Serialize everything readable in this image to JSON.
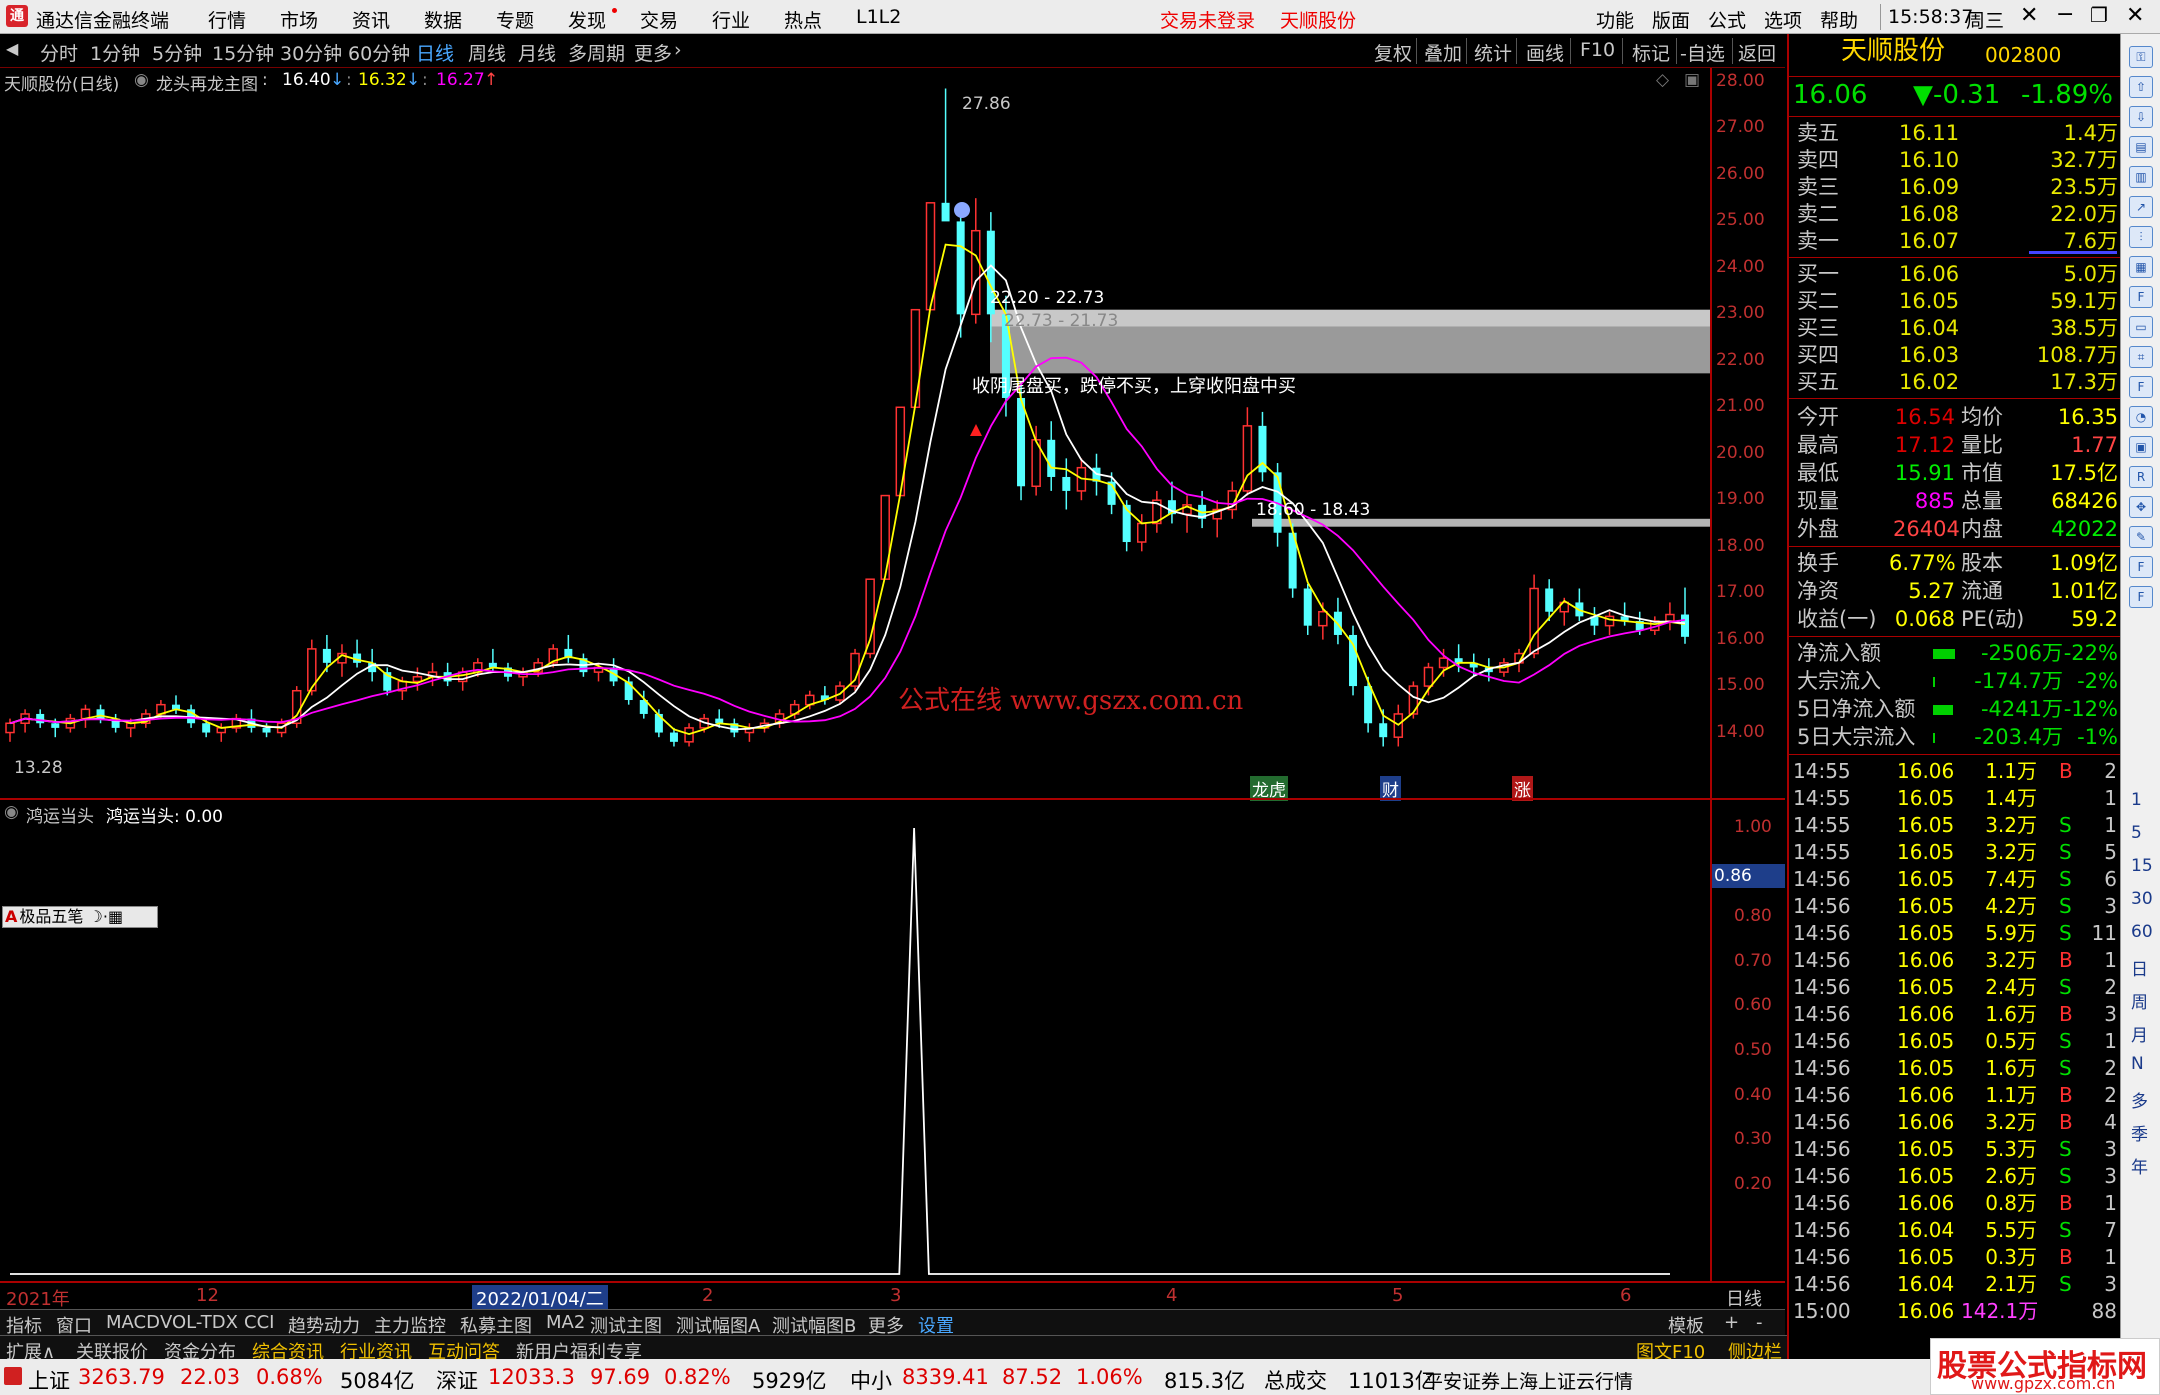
{
  "app": {
    "title": "通达信金融终端",
    "login_status": "交易未登录",
    "stock_name": "天顺股份",
    "time": "15:58:37",
    "weekday": "周三"
  },
  "menu": {
    "items": [
      "行情",
      "市场",
      "资讯",
      "数据",
      "专题",
      "发现",
      "交易",
      "行业",
      "热点",
      "L1L2"
    ],
    "right": [
      "功能",
      "版面",
      "公式",
      "选项",
      "帮助"
    ]
  },
  "periods": [
    "分时",
    "1分钟",
    "5分钟",
    "15分钟",
    "30分钟",
    "60分钟",
    "日线",
    "周线",
    "月线",
    "多周期",
    "更多"
  ],
  "tools": [
    "复权",
    "叠加",
    "统计",
    "画线",
    "F10",
    "标记",
    "-自选",
    "返回"
  ],
  "main_chart": {
    "header_name": "天顺股份(日线)",
    "indicator": "龙头再龙主图",
    "v1": "16.40",
    "v2": "16.32",
    "v3": "16.27",
    "high_label": "27.86",
    "low_label": "13.28",
    "zone1_a": "22.20 - 22.73",
    "zone1_b": "22.73 - 21.73",
    "zone2": "18.60 - 18.43",
    "annotation": "收阴尾盘买，跌停不买，上穿收阳盘中买",
    "watermark": "公式在线   www.gszx.com.cn",
    "markers": [
      "龙虎",
      "财",
      "涨"
    ]
  },
  "sub_chart": {
    "name": "鸿运当头",
    "label": "鸿运当头: 0.00",
    "badge": "0.86",
    "toolbar_label": "极品五笔"
  },
  "chart_data": [
    {
      "type": "candlestick",
      "title": "龙头再龙主图",
      "ylim": [
        13.28,
        28.0
      ],
      "yticks": [
        "28.00",
        "27.00",
        "26.00",
        "25.00",
        "24.00",
        "23.00",
        "22.00",
        "21.00",
        "20.00",
        "19.00",
        "18.00",
        "17.00",
        "16.00",
        "15.00",
        "14.00"
      ],
      "x_labels": [
        "2021年",
        "12",
        "2022/01/04/二",
        "2",
        "3",
        "4",
        "5",
        "6"
      ],
      "ohlc": [
        [
          14.0,
          14.3,
          13.8,
          14.2
        ],
        [
          14.2,
          14.5,
          14.0,
          14.4
        ],
        [
          14.4,
          14.5,
          14.1,
          14.2
        ],
        [
          14.2,
          14.3,
          13.9,
          14.1
        ],
        [
          14.1,
          14.4,
          14.0,
          14.3
        ],
        [
          14.3,
          14.6,
          14.1,
          14.5
        ],
        [
          14.5,
          14.6,
          14.2,
          14.3
        ],
        [
          14.3,
          14.4,
          14.0,
          14.1
        ],
        [
          14.1,
          14.3,
          13.9,
          14.2
        ],
        [
          14.2,
          14.5,
          14.1,
          14.4
        ],
        [
          14.4,
          14.7,
          14.3,
          14.6
        ],
        [
          14.6,
          14.8,
          14.4,
          14.5
        ],
        [
          14.5,
          14.6,
          14.1,
          14.2
        ],
        [
          14.2,
          14.3,
          13.9,
          14.0
        ],
        [
          14.0,
          14.2,
          13.8,
          14.1
        ],
        [
          14.1,
          14.4,
          14.0,
          14.3
        ],
        [
          14.3,
          14.5,
          14.0,
          14.1
        ],
        [
          14.1,
          14.2,
          13.9,
          14.0
        ],
        [
          14.0,
          14.3,
          13.9,
          14.2
        ],
        [
          14.2,
          15.0,
          14.1,
          14.9
        ],
        [
          14.9,
          16.0,
          14.8,
          15.8
        ],
        [
          15.8,
          16.1,
          15.3,
          15.5
        ],
        [
          15.5,
          15.9,
          15.2,
          15.7
        ],
        [
          15.7,
          16.0,
          15.4,
          15.5
        ],
        [
          15.5,
          15.8,
          15.1,
          15.3
        ],
        [
          15.3,
          15.4,
          14.8,
          14.9
        ],
        [
          14.9,
          15.2,
          14.7,
          15.1
        ],
        [
          15.1,
          15.4,
          14.9,
          15.2
        ],
        [
          15.2,
          15.5,
          15.0,
          15.3
        ],
        [
          15.3,
          15.5,
          15.0,
          15.1
        ],
        [
          15.1,
          15.4,
          14.9,
          15.3
        ],
        [
          15.3,
          15.6,
          15.2,
          15.5
        ],
        [
          15.5,
          15.8,
          15.3,
          15.4
        ],
        [
          15.4,
          15.5,
          15.1,
          15.2
        ],
        [
          15.2,
          15.4,
          15.0,
          15.3
        ],
        [
          15.3,
          15.6,
          15.2,
          15.5
        ],
        [
          15.5,
          15.9,
          15.4,
          15.8
        ],
        [
          15.8,
          16.1,
          15.5,
          15.6
        ],
        [
          15.6,
          15.7,
          15.2,
          15.3
        ],
        [
          15.3,
          15.5,
          15.1,
          15.4
        ],
        [
          15.4,
          15.6,
          15.0,
          15.1
        ],
        [
          15.1,
          15.2,
          14.6,
          14.7
        ],
        [
          14.7,
          14.9,
          14.3,
          14.4
        ],
        [
          14.4,
          14.5,
          13.9,
          14.0
        ],
        [
          14.0,
          14.1,
          13.7,
          13.8
        ],
        [
          13.8,
          14.2,
          13.7,
          14.1
        ],
        [
          14.1,
          14.4,
          14.0,
          14.3
        ],
        [
          14.3,
          14.5,
          14.1,
          14.2
        ],
        [
          14.2,
          14.3,
          13.9,
          14.0
        ],
        [
          14.0,
          14.2,
          13.8,
          14.1
        ],
        [
          14.1,
          14.3,
          14.0,
          14.2
        ],
        [
          14.2,
          14.5,
          14.1,
          14.4
        ],
        [
          14.4,
          14.7,
          14.3,
          14.6
        ],
        [
          14.6,
          14.9,
          14.5,
          14.8
        ],
        [
          14.8,
          15.0,
          14.6,
          14.7
        ],
        [
          14.7,
          15.1,
          14.6,
          15.0
        ],
        [
          15.0,
          15.8,
          14.9,
          15.7
        ],
        [
          15.7,
          17.3,
          15.6,
          17.3
        ],
        [
          17.3,
          19.1,
          17.3,
          19.1
        ],
        [
          19.1,
          21.0,
          19.1,
          21.0
        ],
        [
          21.0,
          23.1,
          21.0,
          23.1
        ],
        [
          23.1,
          25.4,
          23.1,
          25.4
        ],
        [
          25.4,
          27.86,
          25.2,
          25.0
        ],
        [
          25.0,
          25.3,
          22.5,
          23.0
        ],
        [
          23.0,
          25.5,
          22.8,
          24.8
        ],
        [
          24.8,
          25.2,
          22.4,
          23.0
        ],
        [
          23.0,
          23.4,
          20.8,
          21.2
        ],
        [
          21.2,
          21.5,
          19.0,
          19.3
        ],
        [
          19.3,
          20.6,
          19.1,
          20.3
        ],
        [
          20.3,
          20.7,
          19.2,
          19.5
        ],
        [
          19.5,
          19.9,
          18.8,
          19.2
        ],
        [
          19.2,
          19.9,
          19.0,
          19.7
        ],
        [
          19.7,
          20.0,
          19.1,
          19.4
        ],
        [
          19.4,
          19.6,
          18.7,
          18.9
        ],
        [
          18.9,
          19.0,
          17.9,
          18.1
        ],
        [
          18.1,
          18.7,
          17.9,
          18.5
        ],
        [
          18.5,
          19.2,
          18.3,
          19.0
        ],
        [
          19.0,
          19.4,
          18.5,
          18.7
        ],
        [
          18.7,
          19.1,
          18.3,
          18.9
        ],
        [
          18.9,
          19.2,
          18.4,
          18.6
        ],
        [
          18.6,
          19.0,
          18.2,
          18.8
        ],
        [
          18.8,
          19.4,
          18.6,
          19.2
        ],
        [
          19.2,
          21.0,
          19.1,
          20.6
        ],
        [
          20.6,
          20.9,
          19.4,
          19.6
        ],
        [
          19.6,
          19.8,
          18.0,
          18.3
        ],
        [
          18.3,
          18.5,
          16.9,
          17.1
        ],
        [
          17.1,
          17.2,
          16.1,
          16.3
        ],
        [
          16.3,
          16.8,
          16.0,
          16.6
        ],
        [
          16.6,
          16.9,
          15.9,
          16.1
        ],
        [
          16.1,
          16.3,
          14.8,
          15.0
        ],
        [
          15.0,
          15.2,
          14.0,
          14.2
        ],
        [
          14.2,
          14.5,
          13.7,
          13.9
        ],
        [
          13.9,
          14.6,
          13.7,
          14.4
        ],
        [
          14.4,
          15.1,
          14.3,
          15.0
        ],
        [
          15.0,
          15.5,
          14.8,
          15.4
        ],
        [
          15.4,
          15.8,
          15.2,
          15.6
        ],
        [
          15.6,
          15.9,
          15.3,
          15.5
        ],
        [
          15.5,
          15.7,
          15.2,
          15.4
        ],
        [
          15.4,
          15.6,
          15.1,
          15.3
        ],
        [
          15.3,
          15.6,
          15.2,
          15.5
        ],
        [
          15.5,
          15.8,
          15.3,
          15.7
        ],
        [
          15.7,
          17.4,
          15.6,
          17.1
        ],
        [
          17.1,
          17.3,
          16.4,
          16.6
        ],
        [
          16.6,
          16.9,
          16.3,
          16.8
        ],
        [
          16.8,
          17.1,
          16.4,
          16.5
        ],
        [
          16.5,
          16.7,
          16.1,
          16.3
        ],
        [
          16.3,
          16.6,
          16.1,
          16.5
        ],
        [
          16.5,
          16.8,
          16.3,
          16.4
        ],
        [
          16.4,
          16.6,
          16.1,
          16.2
        ],
        [
          16.2,
          16.5,
          16.1,
          16.4
        ],
        [
          16.4,
          16.8,
          16.2,
          16.54
        ],
        [
          16.54,
          17.12,
          15.91,
          16.06
        ]
      ],
      "series": [
        {
          "name": "16.40",
          "color": "#ffffff"
        },
        {
          "name": "16.32",
          "color": "#ffff00"
        },
        {
          "name": "16.27",
          "color": "#ff00ff"
        }
      ]
    },
    {
      "type": "line",
      "title": "鸿运当头",
      "ylim": [
        0,
        1
      ],
      "yticks": [
        "1.00",
        "0.80",
        "0.70",
        "0.60",
        "0.50",
        "0.40",
        "0.30",
        "0.20"
      ],
      "spike_index": 61,
      "spike_value": 1.0,
      "count": 113
    }
  ],
  "quote": {
    "name": "天顺股份",
    "code": "002800",
    "price": "16.06",
    "change": "▼-0.31",
    "pct": "-1.89%",
    "asks": [
      {
        "label": "卖五",
        "price": "16.11",
        "vol": "1.4万"
      },
      {
        "label": "卖四",
        "price": "16.10",
        "vol": "32.7万"
      },
      {
        "label": "卖三",
        "price": "16.09",
        "vol": "23.5万"
      },
      {
        "label": "卖二",
        "price": "16.08",
        "vol": "22.0万"
      },
      {
        "label": "卖一",
        "price": "16.07",
        "vol": "7.6万"
      }
    ],
    "bids": [
      {
        "label": "买一",
        "price": "16.06",
        "vol": "5.0万"
      },
      {
        "label": "买二",
        "price": "16.05",
        "vol": "59.1万"
      },
      {
        "label": "买三",
        "price": "16.04",
        "vol": "38.5万"
      },
      {
        "label": "买四",
        "price": "16.03",
        "vol": "108.7万"
      },
      {
        "label": "买五",
        "price": "16.02",
        "vol": "17.3万"
      }
    ],
    "stats1": [
      [
        "今开",
        "16.54",
        "均价",
        "16.35"
      ],
      [
        "最高",
        "17.12",
        "量比",
        "1.77"
      ],
      [
        "最低",
        "15.91",
        "市值",
        "17.5亿"
      ],
      [
        "现量",
        "885",
        "总量",
        "68426"
      ],
      [
        "外盘",
        "26404",
        "内盘",
        "42022"
      ]
    ],
    "stats2": [
      [
        "换手",
        "6.77%",
        "股本",
        "1.09亿"
      ],
      [
        "净资",
        "5.27",
        "流通",
        "1.01亿"
      ],
      [
        "收益(一)",
        "0.068",
        "PE(动)",
        "59.2"
      ]
    ],
    "flows": [
      [
        "净流入额",
        "-2506万",
        "-22%"
      ],
      [
        "大宗流入",
        "-174.7万",
        "-2%"
      ],
      [
        "5日净流入额",
        "-4241万",
        "-12%"
      ],
      [
        "5日大宗流入",
        "-203.4万",
        "-1%"
      ]
    ],
    "trades": [
      [
        "14:55",
        "16.06",
        "1.1万",
        "B",
        "2"
      ],
      [
        "14:55",
        "16.05",
        "1.4万",
        "",
        "1"
      ],
      [
        "14:55",
        "16.05",
        "3.2万",
        "S",
        "1"
      ],
      [
        "14:55",
        "16.05",
        "3.2万",
        "S",
        "5"
      ],
      [
        "14:56",
        "16.05",
        "7.4万",
        "S",
        "6"
      ],
      [
        "14:56",
        "16.05",
        "4.2万",
        "S",
        "3"
      ],
      [
        "14:56",
        "16.05",
        "5.9万",
        "S",
        "11"
      ],
      [
        "14:56",
        "16.06",
        "3.2万",
        "B",
        "1"
      ],
      [
        "14:56",
        "16.05",
        "2.4万",
        "S",
        "2"
      ],
      [
        "14:56",
        "16.06",
        "1.6万",
        "B",
        "3"
      ],
      [
        "14:56",
        "16.05",
        "0.5万",
        "S",
        "1"
      ],
      [
        "14:56",
        "16.05",
        "1.6万",
        "S",
        "2"
      ],
      [
        "14:56",
        "16.06",
        "1.1万",
        "B",
        "2"
      ],
      [
        "14:56",
        "16.06",
        "3.2万",
        "B",
        "4"
      ],
      [
        "14:56",
        "16.05",
        "5.3万",
        "S",
        "3"
      ],
      [
        "14:56",
        "16.05",
        "2.6万",
        "S",
        "3"
      ],
      [
        "14:56",
        "16.06",
        "0.8万",
        "B",
        "1"
      ],
      [
        "14:56",
        "16.04",
        "5.5万",
        "S",
        "7"
      ],
      [
        "14:56",
        "16.05",
        "0.3万",
        "B",
        "1"
      ],
      [
        "14:56",
        "16.04",
        "2.1万",
        "S",
        "3"
      ],
      [
        "15:00",
        "16.06",
        "142.1万",
        "",
        "88"
      ]
    ]
  },
  "bottom_tabs": [
    "指标",
    "窗口",
    "MACD",
    "VOL-TDX",
    "CCI",
    "趋势动力",
    "主力监控",
    "私募主图",
    "MA2",
    "测试主图",
    "测试幅图A",
    "测试幅图B",
    "更多",
    "设置"
  ],
  "bottom_tabs2": [
    "扩展∧",
    "关联报价",
    "资金分布",
    "综合资讯",
    "行业资讯",
    "互动问答",
    "新用户福利专享"
  ],
  "bottom_right": {
    "template": "模板",
    "plus": "+",
    "minus": "-",
    "period": "日线",
    "f10": "图文F10",
    "sidebar": "侧边栏《",
    "t1": "笔",
    "t2": "价",
    "t3": "细",
    "t4": "势"
  },
  "sidebar_labels": [
    "1",
    "5",
    "15",
    "30",
    "60",
    "日",
    "周",
    "月",
    "N",
    "多",
    "季",
    "年"
  ],
  "status": {
    "sh_name": "上证",
    "sh": "3263.79",
    "sh_chg": "22.03",
    "sh_pct": "0.68%",
    "sh_amt": "5084亿",
    "sz_name": "深证",
    "sz": "12033.3",
    "sz_chg": "97.69",
    "sz_pct": "0.82%",
    "sz_amt": "5929亿",
    "zx_name": "中小",
    "zx": "8339.41",
    "zx_chg": "87.52",
    "zx_pct": "1.06%",
    "zx_amt": "815.3亿",
    "total_label": "总成交",
    "total": "11013亿",
    "server": "平安证券上海上证云行情"
  },
  "brand": {
    "a": "股票公式指标网",
    "b": "www.gpzx.com.cn"
  }
}
